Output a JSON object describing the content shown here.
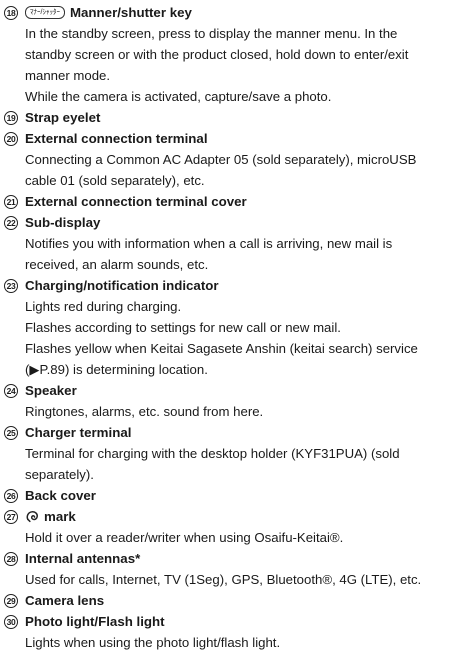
{
  "items": [
    {
      "num": "18",
      "badge": "ﾏﾅｰ/ｼｬｯﾀｰ",
      "title": "Manner/shutter key",
      "lines": [
        "In the standby screen, press to display the manner menu. In the",
        "standby screen or with the product closed, hold down to enter/exit",
        "manner mode.",
        "While the camera is activated, capture/save a photo."
      ]
    },
    {
      "num": "19",
      "title": "Strap eyelet",
      "lines": []
    },
    {
      "num": "20",
      "title": "External connection terminal",
      "lines": [
        "Connecting a Common AC Adapter 05 (sold separately), microUSB",
        "cable 01 (sold separately), etc."
      ]
    },
    {
      "num": "21",
      "title": "External connection terminal cover",
      "lines": []
    },
    {
      "num": "22",
      "title": "Sub-display",
      "lines": [
        "Notifies you with information when a call is arriving, new mail is",
        "received, an alarm sounds, etc."
      ]
    },
    {
      "num": "23",
      "title": "Charging/notification indicator",
      "lines": [
        "Lights red during charging.",
        "Flashes according to settings for new call or new mail.",
        "Flashes yellow when Keitai Sagasete Anshin (keitai search) service",
        "(▶P.89) is determining location."
      ]
    },
    {
      "num": "24",
      "title": "Speaker",
      "lines": [
        "Ringtones, alarms, etc. sound from here."
      ]
    },
    {
      "num": "25",
      "title": "Charger terminal",
      "lines": [
        "Terminal for charging with the desktop holder (KYF31PUA) (sold",
        "separately)."
      ]
    },
    {
      "num": "26",
      "title": "Back cover",
      "lines": []
    },
    {
      "num": "27",
      "title": "mark",
      "lines": [
        "Hold it over a reader/writer when using Osaifu-Keitai®."
      ]
    },
    {
      "num": "28",
      "title": "Internal antennas*",
      "lines": [
        "Used for calls, Internet, TV (1Seg), GPS, Bluetooth®, 4G (LTE), etc."
      ]
    },
    {
      "num": "29",
      "title": "Camera lens",
      "lines": []
    },
    {
      "num": "30",
      "title": "Photo light/Flash light",
      "lines": [
        "Lights when using the photo light/flash light."
      ]
    }
  ]
}
